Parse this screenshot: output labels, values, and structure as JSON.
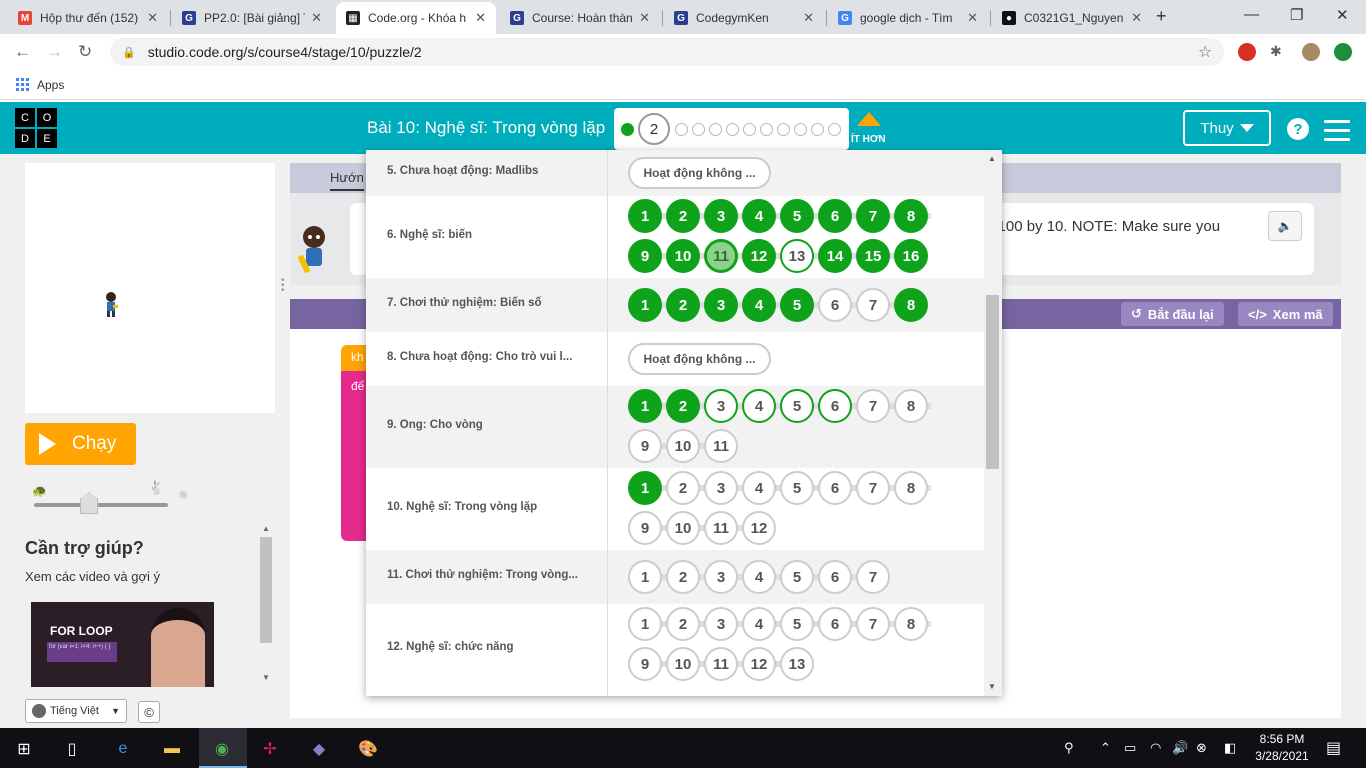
{
  "browser": {
    "tabs": [
      {
        "title": "Hộp thư đến (152)",
        "favicon": "gmail-icon",
        "color": "#ea4335",
        "glyph": "M"
      },
      {
        "title": "PP2.0: [Bài giảng] T",
        "favicon": "codegym-icon",
        "color": "#2a3f8f",
        "glyph": "G"
      },
      {
        "title": "Code.org - Khóa h",
        "favicon": "codeorg-icon",
        "color": "#222222",
        "glyph": "▦"
      },
      {
        "title": "Course: Hoàn thàn",
        "favicon": "codegym-icon",
        "color": "#2a3f8f",
        "glyph": "G"
      },
      {
        "title": "CodegymKen",
        "favicon": "codegym-icon",
        "color": "#2a3f8f",
        "glyph": "G"
      },
      {
        "title": "google dịch - Tìm",
        "favicon": "google-icon",
        "color": "#4285f4",
        "glyph": "G"
      },
      {
        "title": "C0321G1_Nguyen",
        "favicon": "github-icon",
        "color": "#111111",
        "glyph": "●"
      }
    ],
    "new_tab": "+",
    "url": "studio.code.org/s/course4/stage/10/puzzle/2",
    "bookmarks_apps": "Apps"
  },
  "header": {
    "logo_letters": [
      "C",
      "O",
      "D",
      "E"
    ],
    "lesson_title": "Bài 10: Nghệ sĩ: Trong vòng lặp",
    "current_puzzle": "2",
    "less_label": "ÍT HƠN",
    "user_name": "Thuy",
    "help": "?"
  },
  "left": {
    "run_label": "Chạy",
    "help_title": "Cần trợ giúp?",
    "help_sub": "Xem các video và gợi ý",
    "video_title": "FOR LOOP",
    "video_code": "for (var i=1; i<4; i++) { }",
    "language": "Tiếng Việt",
    "copyright": "©"
  },
  "instructions": {
    "tab_label": "Hướn",
    "text": "o 100 by 10. NOTE: Make sure you"
  },
  "workspace": {
    "reset_label": "Bắt đầu lại",
    "show_code_label": "Xem mã",
    "block_hat": "kh",
    "block_loop": "đế"
  },
  "progress": {
    "rows": [
      {
        "label": "5. Chưa hoạt động: Madlibs",
        "unplugged": "Hoạt động không ...",
        "shaded": true
      },
      {
        "label": "6. Nghệ sĩ: biến",
        "shaded": false,
        "bubbles": [
          [
            "1",
            "done"
          ],
          [
            "2",
            "done"
          ],
          [
            "3",
            "done"
          ],
          [
            "4",
            "done"
          ],
          [
            "5",
            "done"
          ],
          [
            "6",
            "done"
          ],
          [
            "7",
            "done"
          ],
          [
            "8",
            "done"
          ],
          [
            "9",
            "done"
          ],
          [
            "10",
            "done"
          ],
          [
            "11",
            "current"
          ],
          [
            "12",
            "done"
          ],
          [
            "13",
            "attempt"
          ],
          [
            "14",
            "done"
          ],
          [
            "15",
            "done"
          ],
          [
            "16",
            "done"
          ]
        ]
      },
      {
        "label": "7. Chơi thử nghiệm: Biến số",
        "shaded": true,
        "bubbles": [
          [
            "1",
            "done"
          ],
          [
            "2",
            "done"
          ],
          [
            "3",
            "done"
          ],
          [
            "4",
            "done"
          ],
          [
            "5",
            "done"
          ],
          [
            "6",
            "none"
          ],
          [
            "7",
            "none"
          ],
          [
            "8",
            "done"
          ]
        ]
      },
      {
        "label": "8. Chưa hoạt động: Cho trò vui l...",
        "unplugged": "Hoạt động không ...",
        "shaded": false
      },
      {
        "label": "9. Ong: Cho vòng",
        "shaded": true,
        "bubbles": [
          [
            "1",
            "done"
          ],
          [
            "2",
            "done"
          ],
          [
            "3",
            "attempt"
          ],
          [
            "4",
            "attempt"
          ],
          [
            "5",
            "attempt"
          ],
          [
            "6",
            "attempt"
          ],
          [
            "7",
            "none"
          ],
          [
            "8",
            "none"
          ],
          [
            "9",
            "none"
          ],
          [
            "10",
            "none"
          ],
          [
            "11",
            "none"
          ]
        ]
      },
      {
        "label": "10. Nghệ sĩ: Trong vòng lặp",
        "shaded": false,
        "bubbles": [
          [
            "1",
            "done"
          ],
          [
            "2",
            "none"
          ],
          [
            "3",
            "none"
          ],
          [
            "4",
            "none"
          ],
          [
            "5",
            "none"
          ],
          [
            "6",
            "none"
          ],
          [
            "7",
            "none"
          ],
          [
            "8",
            "none"
          ],
          [
            "9",
            "none"
          ],
          [
            "10",
            "none"
          ],
          [
            "11",
            "none"
          ],
          [
            "12",
            "none"
          ]
        ]
      },
      {
        "label": "11. Chơi thử nghiệm: Trong vòng...",
        "shaded": true,
        "bubbles": [
          [
            "1",
            "none"
          ],
          [
            "2",
            "none"
          ],
          [
            "3",
            "none"
          ],
          [
            "4",
            "none"
          ],
          [
            "5",
            "none"
          ],
          [
            "6",
            "none"
          ],
          [
            "7",
            "none"
          ]
        ]
      },
      {
        "label": "12. Nghệ sĩ: chức năng",
        "shaded": false,
        "bubbles": [
          [
            "1",
            "none"
          ],
          [
            "2",
            "none"
          ],
          [
            "3",
            "none"
          ],
          [
            "4",
            "none"
          ],
          [
            "5",
            "none"
          ],
          [
            "6",
            "none"
          ],
          [
            "7",
            "none"
          ],
          [
            "8",
            "none"
          ],
          [
            "9",
            "none"
          ],
          [
            "10",
            "none"
          ],
          [
            "11",
            "none"
          ],
          [
            "12",
            "none"
          ],
          [
            "13",
            "none"
          ]
        ]
      }
    ]
  },
  "taskbar": {
    "time": "8:56 PM",
    "date": "3/28/2021"
  },
  "colors": {
    "codeorg_teal": "#00adbc",
    "run_orange": "#ffa400",
    "progress_green": "#0ea31a",
    "workspace_purple": "#7665a0"
  }
}
